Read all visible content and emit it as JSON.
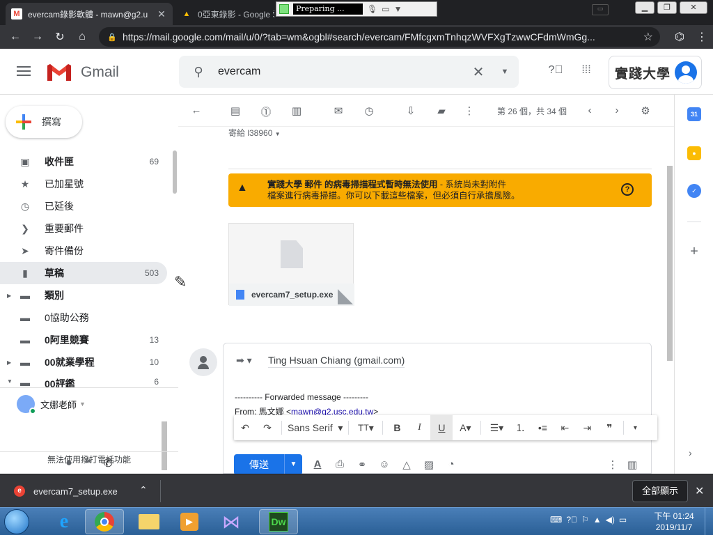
{
  "browser": {
    "tabs": [
      {
        "title": "evercam錄影軟體 - mawn@g2.u"
      },
      {
        "title": "0亞東錄影 - Google 雲"
      }
    ],
    "recorder_status": "Preparing ...",
    "url": "https://mail.google.com/mail/u/0/?tab=wm&ogbl#search/evercam/FMfcgxmTnhqzWVFXgTzwwCFdmWmGg..."
  },
  "gmail": {
    "logo_text": "Gmail",
    "search_value": "evercam",
    "org_name": "實踐大學",
    "compose_label": "撰寫",
    "nav": [
      {
        "label": "收件匣",
        "count": "69",
        "icon": "inbox-icon"
      },
      {
        "label": "已加星號",
        "count": "",
        "icon": "star-icon"
      },
      {
        "label": "已延後",
        "count": "",
        "icon": "clock-icon"
      },
      {
        "label": "重要郵件",
        "count": "",
        "icon": "important-icon"
      },
      {
        "label": "寄件備份",
        "count": "",
        "icon": "sent-icon"
      },
      {
        "label": "草稿",
        "count": "503",
        "icon": "draft-icon"
      },
      {
        "label": "類別",
        "count": "",
        "icon": "label-icon"
      },
      {
        "label": "0協助公務",
        "count": "",
        "icon": "label-icon"
      },
      {
        "label": "0阿里競賽",
        "count": "13",
        "icon": "label-icon"
      },
      {
        "label": "00就業學程",
        "count": "10",
        "icon": "label-icon"
      },
      {
        "label": "00評鑑",
        "count": "6",
        "icon": "label-icon"
      }
    ],
    "hangouts_user": "文娜老師",
    "hangouts_msg": "無法使用撥打電話功能",
    "pager": "第 26 個，共 34 個",
    "recipient_line": "寄給 l38960",
    "virus_warning": {
      "strong": "實踐大學 郵件 的病毒掃描程式暫時無法使用",
      "rest_line1": " - 系統尚未對附件",
      "line2": "檔案進行病毒掃描。你可以下載這些檔案，但必須自行承擔風險。"
    },
    "attachment_name": "evercam7_setup.exe",
    "reply": {
      "to": "Ting Hsuan Chiang (gmail.com)",
      "fwd_line": "---------- Forwarded message ---------",
      "from_label": "From: ",
      "from_name": "馬文娜",
      "from_email": "mawn@g2.usc.edu.tw",
      "font": "Sans Serif",
      "send_label": "傳送"
    }
  },
  "downloads": {
    "file": "evercam7_setup.exe",
    "show_all": "全部顯示"
  },
  "taskbar": {
    "time": "下午 01:24",
    "date": "2019/11/7"
  },
  "colors": {
    "warning": "#f9ab00",
    "send": "#1a73e8",
    "gmail_red": "#ea4335"
  }
}
